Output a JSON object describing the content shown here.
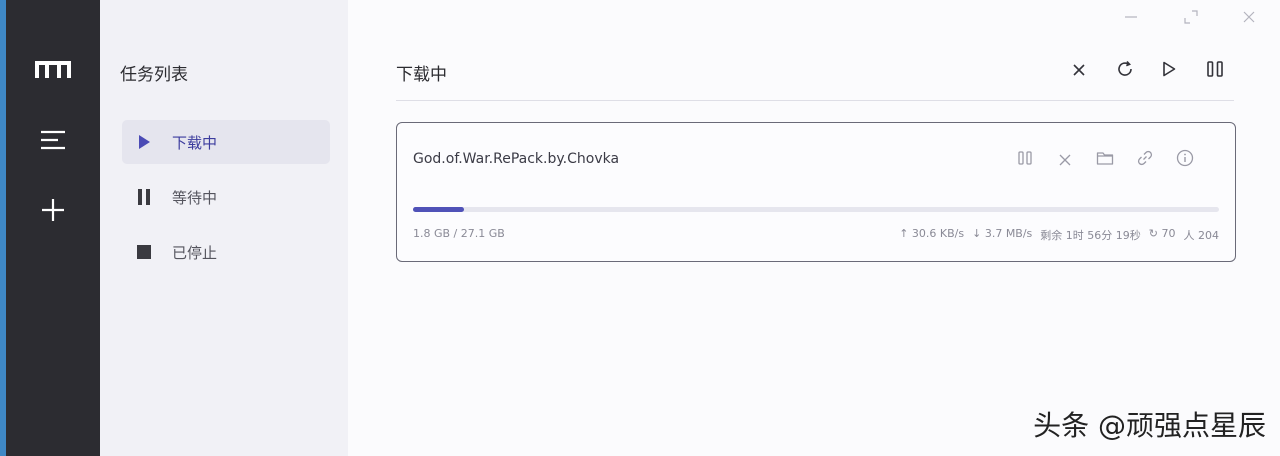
{
  "rail": {
    "items": [
      {
        "icon": "logo-m-icon"
      },
      {
        "icon": "menu-icon"
      },
      {
        "icon": "plus-icon"
      }
    ]
  },
  "sidebar": {
    "title": "任务列表",
    "items": [
      {
        "label": "下载中",
        "icon": "play-icon",
        "active": true
      },
      {
        "label": "等待中",
        "icon": "pause-icon",
        "active": false
      },
      {
        "label": "已停止",
        "icon": "stop-icon",
        "active": false
      }
    ]
  },
  "window": {
    "controls": [
      "minimize-icon",
      "maximize-icon",
      "close-icon"
    ]
  },
  "main": {
    "title": "下载中",
    "toolbar": [
      "close-icon",
      "refresh-icon",
      "play-icon",
      "pause-icon"
    ]
  },
  "task": {
    "name": "God.of.War.RePack.by.Chovka",
    "actions": [
      "pause-icon",
      "close-icon",
      "folder-icon",
      "link-icon",
      "info-icon"
    ],
    "progress": 0.063,
    "size": "1.8 GB / 27.1 GB",
    "upload_speed": "↑ 30.6 KB/s",
    "download_speed": "↓ 3.7 MB/s",
    "remaining": "剩余 1时 56分 19秒",
    "connections": "↻ 70",
    "peers": "人 204"
  },
  "colors": {
    "accent": "#5052b8",
    "rail": "#2c2c31",
    "sidebar": "#f1f1f6"
  },
  "watermark": "头条 @顽强点星辰"
}
